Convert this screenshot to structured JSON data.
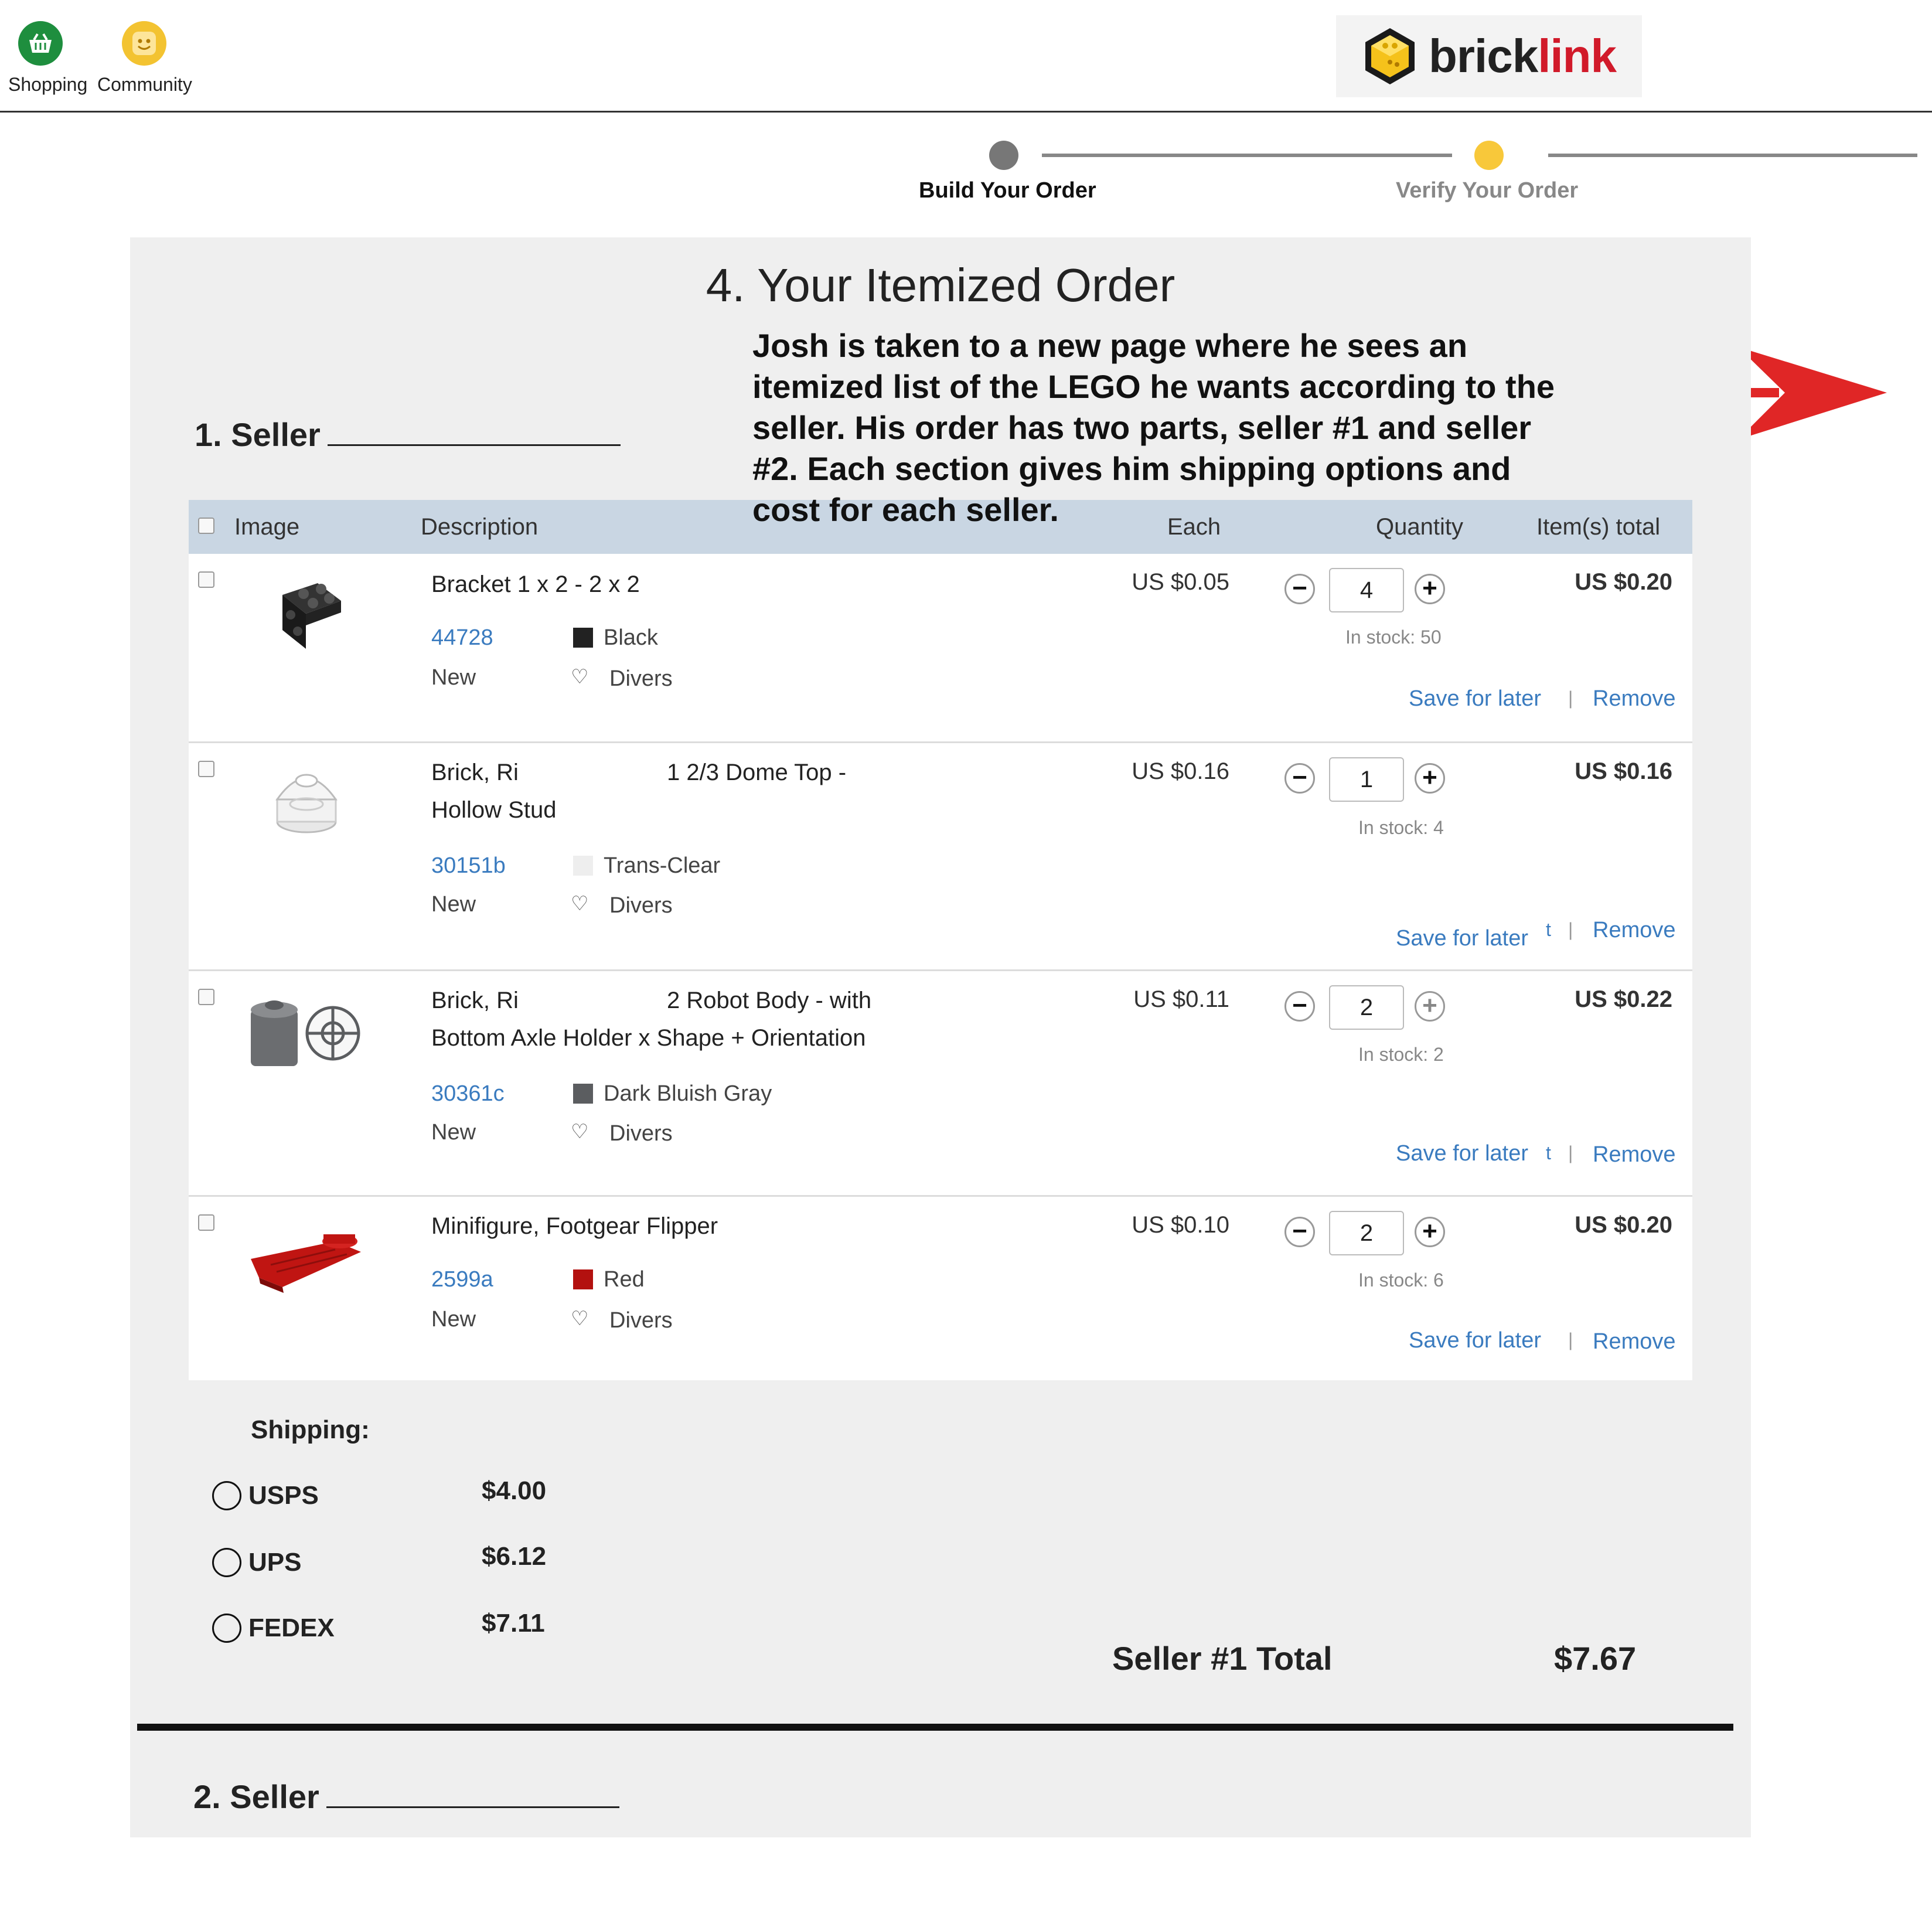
{
  "nav": {
    "items": [
      {
        "label": "Shopping",
        "icon": "basket-icon",
        "color": "#1e8e3e"
      },
      {
        "label": "Community",
        "icon": "smiley-icon",
        "color": "#f3c331"
      }
    ]
  },
  "logo": {
    "brick": "brick",
    "link": "link",
    "accent": "#d11a2a"
  },
  "steps": [
    {
      "label": "Build Your Order",
      "color": "#777777"
    },
    {
      "label": "Verify Your Order",
      "color": "#f8c83a"
    }
  ],
  "page_title": "4. Your Itemized Order",
  "seller1_heading": "1. Seller",
  "seller2_heading": "2. Seller",
  "annotation": "Josh is taken to a new page where he sees an itemized list of the LEGO he wants according to the seller. His order has two parts, seller #1 and seller #2. Each section gives him shipping options and cost for each seller.",
  "table": {
    "headers": {
      "image": "Image",
      "description": "Description",
      "each": "Each",
      "quantity": "Quantity",
      "total": "Item(s) total"
    },
    "actions": {
      "save": "Save for later",
      "remove": "Remove",
      "separator": "|"
    },
    "rows": [
      {
        "desc1": "Bracket 1 x 2 - 2 x 2",
        "desc2": "",
        "part": "44728",
        "color_name": "Black",
        "color": "#222222",
        "condition": "New",
        "store": "Divers",
        "price": "US $0.05",
        "qty": "4",
        "stock": "In stock: 50",
        "total": "US $0.20"
      },
      {
        "desc1": "Brick, Ri",
        "desc1b": "1 2/3 Dome Top -",
        "desc2": "Hollow Stud",
        "part": "30151b",
        "color_name": "Trans-Clear",
        "color": "#eeeeee",
        "condition": "New",
        "store": "Divers",
        "price": "US $0.16",
        "qty": "1",
        "stock": "In stock: 4",
        "total": "US $0.16",
        "stray": "t"
      },
      {
        "desc1": "Brick, Ri",
        "desc1b": "2 Robot Body - with",
        "desc2": "Bottom Axle Holder x Shape + Orientation",
        "part": "30361c",
        "color_name": "Dark Bluish Gray",
        "color": "#5b5d60",
        "condition": "New",
        "store": "Divers",
        "price": "US $0.11",
        "qty": "2",
        "stock": "In stock: 2",
        "total": "US $0.22",
        "stray": "t"
      },
      {
        "desc1": "Minifigure, Footgear Flipper",
        "desc2": "",
        "part": "2599a",
        "color_name": "Red",
        "color": "#b3110f",
        "condition": "New",
        "store": "Divers",
        "price": "US $0.10",
        "qty": "2",
        "stock": "In stock: 6",
        "total": "US $0.20"
      }
    ]
  },
  "shipping": {
    "title": "Shipping:",
    "options": [
      {
        "name": "USPS",
        "price": "$4.00"
      },
      {
        "name": "UPS",
        "price": "$6.12"
      },
      {
        "name": "FEDEX",
        "price": "$7.11"
      }
    ]
  },
  "seller_total": {
    "label": "Seller #1 Total",
    "value": "$7.67"
  },
  "arrow_color": "#e02626"
}
